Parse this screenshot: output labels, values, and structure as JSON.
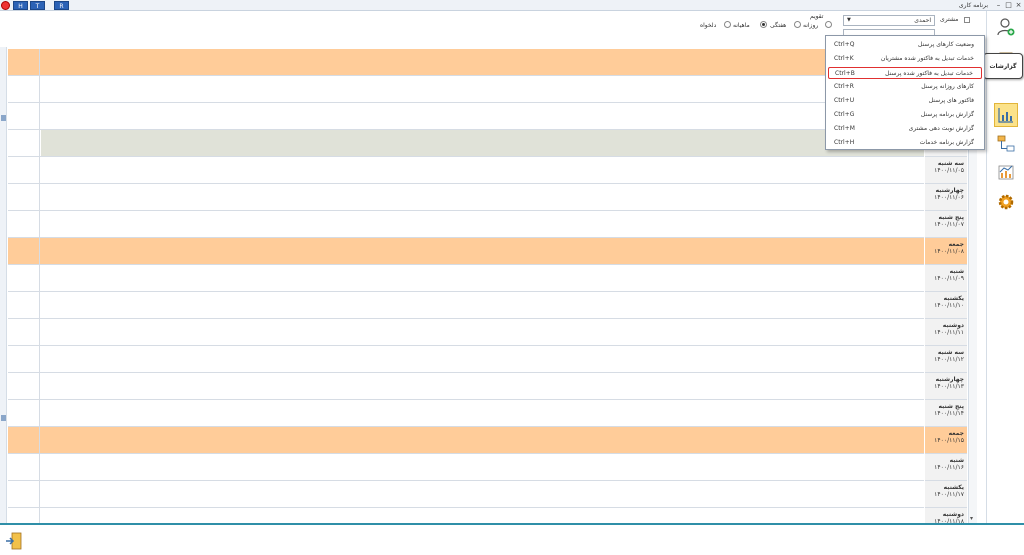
{
  "titlebar": {
    "title": "برنامه کاری",
    "quick_buttons": [
      "H",
      "T",
      "R"
    ],
    "minimize": "–",
    "maximize": "□",
    "close": "×"
  },
  "filter": {
    "customer_label": "مشتری",
    "customer_value": "احمدی",
    "calendar_label": "تقویم",
    "radios": [
      {
        "label": "روزانه",
        "selected": false
      },
      {
        "label": "هفتگی",
        "selected": false
      },
      {
        "label": "ماهیانه",
        "selected": true
      },
      {
        "label": "دلخواه",
        "selected": false
      }
    ]
  },
  "tooltip": {
    "text": "گزارشات"
  },
  "menu": {
    "items": [
      {
        "label": "وضعیت کارهای پرسنل",
        "shortcut": "Ctrl+Q",
        "highlighted": false
      },
      {
        "label": "خدمات تبدیل به فاکتور شده مشتریان",
        "shortcut": "Ctrl+K",
        "highlighted": false
      },
      {
        "label": "خدمات تبدیل به فاکتور شده پرسنل",
        "shortcut": "Ctrl+B",
        "highlighted": true
      },
      {
        "label": "کارهای روزانه پرسنل",
        "shortcut": "Ctrl+R",
        "highlighted": false
      },
      {
        "label": "فاکتور های پرسنل",
        "shortcut": "Ctrl+U",
        "highlighted": false
      },
      {
        "label": "گزارش برنامه پرسنل",
        "shortcut": "Ctrl+G",
        "highlighted": false
      },
      {
        "label": "گزارش نوبت دهی مشتری",
        "shortcut": "Ctrl+M",
        "highlighted": false
      },
      {
        "label": "گزارش برنامه خدمات",
        "shortcut": "Ctrl+H",
        "highlighted": false
      }
    ]
  },
  "days": [
    {
      "name": "",
      "date": "",
      "friday": true
    },
    {
      "name": "",
      "date": "",
      "friday": false
    },
    {
      "name": "",
      "date": "",
      "friday": false
    },
    {
      "name": "",
      "date": "",
      "friday": false,
      "gray": true
    },
    {
      "name": "سه شنبه",
      "date": "۱۴۰۰/۱۱/۰۵",
      "friday": false
    },
    {
      "name": "چهارشنبه",
      "date": "۱۴۰۰/۱۱/۰۶",
      "friday": false
    },
    {
      "name": "پنج شنبه",
      "date": "۱۴۰۰/۱۱/۰۷",
      "friday": false
    },
    {
      "name": "جمعه",
      "date": "۱۴۰۰/۱۱/۰۸",
      "friday": true
    },
    {
      "name": "شنبه",
      "date": "۱۴۰۰/۱۱/۰۹",
      "friday": false
    },
    {
      "name": "یکشنبه",
      "date": "۱۴۰۰/۱۱/۱۰",
      "friday": false
    },
    {
      "name": "دوشنبه",
      "date": "۱۴۰۰/۱۱/۱۱",
      "friday": false
    },
    {
      "name": "سه شنبه",
      "date": "۱۴۰۰/۱۱/۱۲",
      "friday": false
    },
    {
      "name": "چهارشنبه",
      "date": "۱۴۰۰/۱۱/۱۳",
      "friday": false
    },
    {
      "name": "پنج شنبه",
      "date": "۱۴۰۰/۱۱/۱۴",
      "friday": false
    },
    {
      "name": "جمعه",
      "date": "۱۴۰۰/۱۱/۱۵",
      "friday": true
    },
    {
      "name": "شنبه",
      "date": "۱۴۰۰/۱۱/۱۶",
      "friday": false
    },
    {
      "name": "یکشنبه",
      "date": "۱۴۰۰/۱۱/۱۷",
      "friday": false
    },
    {
      "name": "دوشنبه",
      "date": "۱۴۰۰/۱۱/۱۸",
      "friday": false
    }
  ],
  "icons": {
    "add_user": "add-user-icon",
    "reports": "bar-chart-icon",
    "workflow": "flowchart-icon",
    "stats": "line-chart-icon",
    "settings": "gear-icon",
    "exit": "exit-door-icon"
  },
  "colors": {
    "friday_row": "#ffcc99",
    "active_tool": "#fbe28a",
    "highlight_border": "#e03030",
    "accent_line": "#2f8fa8"
  }
}
